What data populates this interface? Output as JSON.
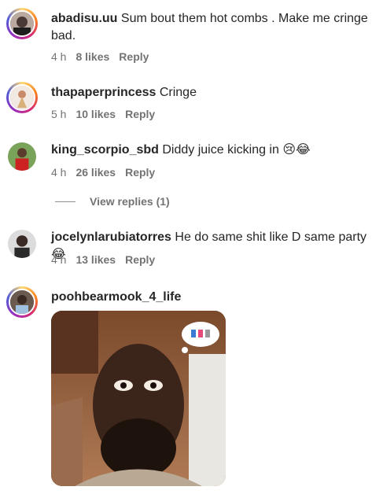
{
  "comments": [
    {
      "username": "abadisu.uu",
      "text": "Sum bout them hot combs . Make me cringe bad.",
      "time": "4 h",
      "likes": "8 likes",
      "reply": "Reply"
    },
    {
      "username": "thapaperprincess",
      "text": "Cringe",
      "time": "5 h",
      "likes": "10 likes",
      "reply": "Reply"
    },
    {
      "username": "king_scorpio_sbd",
      "text": "Diddy juice kicking in 😢😂",
      "time": "4 h",
      "likes": "26 likes",
      "reply": "Reply"
    },
    {
      "username": "jocelynlarubiatorres",
      "text": "He do same shit like D same party😂",
      "time": "4 h",
      "likes": "13 likes",
      "reply": "Reply"
    },
    {
      "username": "poohbearmook_4_life"
    }
  ],
  "view_replies": "View replies (1)",
  "colors": {
    "text": "#262626",
    "meta": "#737373",
    "story_ring": [
      "#feda75",
      "#fa7e1e",
      "#d62976",
      "#962fbf",
      "#4f5bd5"
    ]
  }
}
